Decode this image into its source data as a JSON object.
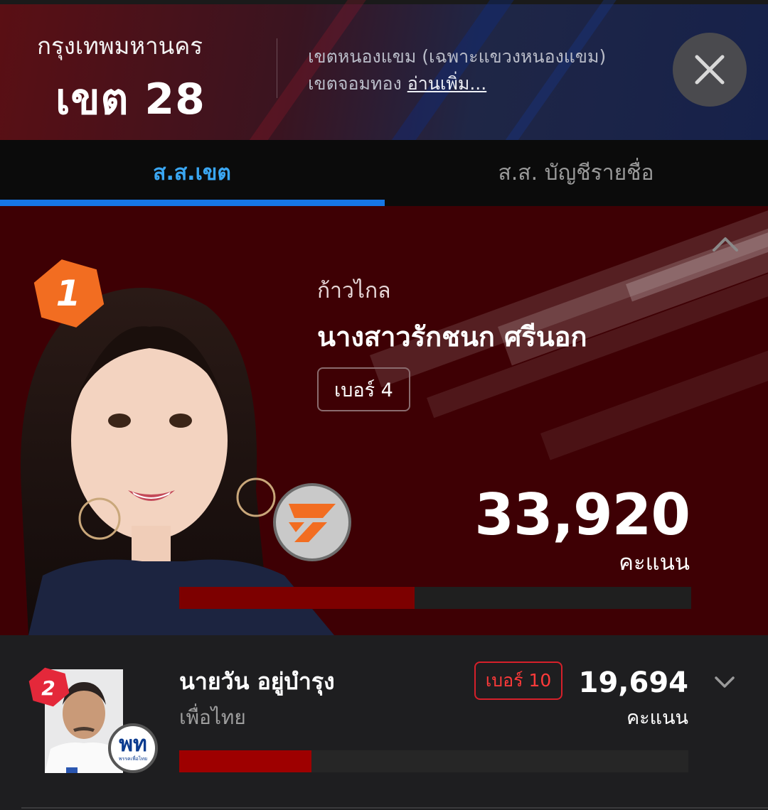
{
  "header": {
    "province": "กรุงเทพมหานคร",
    "district": "เขต 28",
    "area_line1": "เขตหนองแขม (เฉพาะแขวงหนองแขม)",
    "area_line2": "เขตจอมทอง",
    "read_more": "อ่านเพิ่ม...",
    "close_icon": "close-icon"
  },
  "tabs": [
    {
      "label": "ส.ส.เขต",
      "active": true
    },
    {
      "label": "ส.ส. บัญชีรายชื่อ",
      "active": false
    }
  ],
  "winner": {
    "rank": "1",
    "party": "ก้าวไกล",
    "name": "นางสาวรักชนก ศรีนอก",
    "number": "เบอร์ 4",
    "votes": "33,920",
    "votes_unit": "คะแนน",
    "bar_fraction": 0.46,
    "colors": {
      "badge": "#f26d21",
      "bar": "#7d0000",
      "party_logo": "#f26d21"
    }
  },
  "runner_up": {
    "rank": "2",
    "name": "นายวัน อยู่บำรุง",
    "party": "เพื่อไทย",
    "number": "เบอร์ 10",
    "votes": "19,694",
    "votes_unit": "คะแนน",
    "bar_fraction": 0.26,
    "logo_text": "พท",
    "logo_subtext": "พรรคเพื่อไทย",
    "colors": {
      "badge": "#e4283a",
      "bar": "#9e0000",
      "number_border": "#d6202a"
    }
  }
}
